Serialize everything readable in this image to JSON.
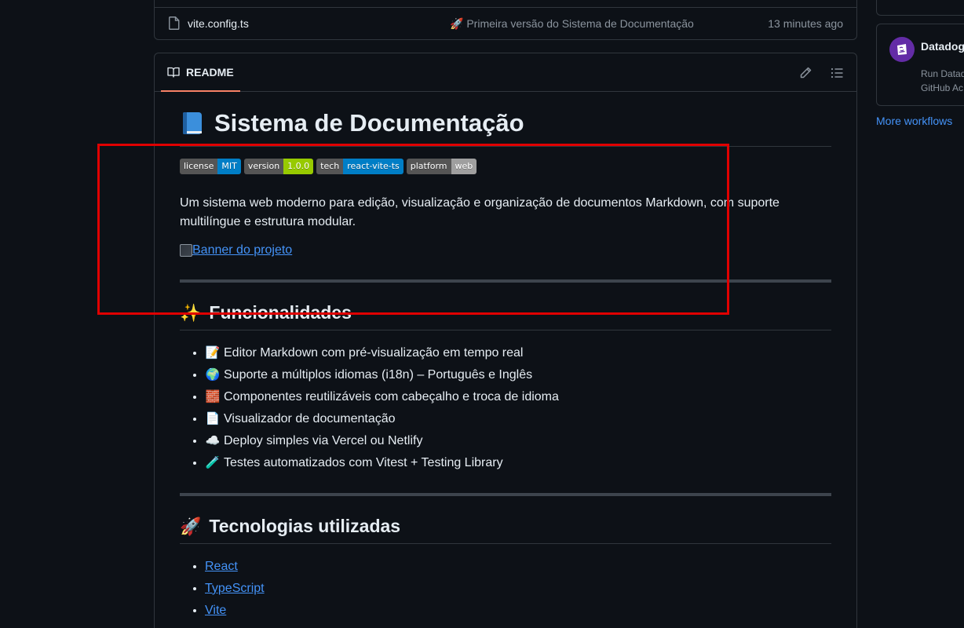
{
  "file_list": {
    "row": {
      "file_name": "vite.config.ts",
      "commit_emoji": "🚀",
      "commit_message": "Primeira versão do Sistema de Documentação",
      "commit_time": "13 minutes ago"
    }
  },
  "readme": {
    "tab_label": "README",
    "title_emoji": "book-icon",
    "title": "Sistema de Documentação",
    "badges": [
      {
        "label": "license",
        "value": "MIT",
        "color": "#007ec6"
      },
      {
        "label": "version",
        "value": "1.0.0",
        "color": "#97ca00"
      },
      {
        "label": "tech",
        "value": "react-vite-ts",
        "color": "#007ec6"
      },
      {
        "label": "platform",
        "value": "web",
        "color": "#9f9f9f"
      }
    ],
    "description": "Um sistema web moderno para edição, visualização e organização de documentos Markdown, com suporte multilíngue e estrutura modular.",
    "banner_alt": "Banner do projeto",
    "features": {
      "emoji": "✨",
      "heading": "Funcionalidades",
      "items": [
        {
          "emoji": "📝",
          "text": "Editor Markdown com pré-visualização em tempo real"
        },
        {
          "emoji": "🌍",
          "text": "Suporte a múltiplos idiomas (i18n) – Português e Inglês"
        },
        {
          "emoji": "🧱",
          "text": "Componentes reutilizáveis com cabeçalho e troca de idioma"
        },
        {
          "emoji": "📄",
          "text": "Visualizador de documentação"
        },
        {
          "emoji": "☁️",
          "text": "Deploy simples via Vercel ou Netlify"
        },
        {
          "emoji": "🧪",
          "text": "Testes automatizados com Vitest + Testing Library"
        }
      ]
    },
    "technologies": {
      "emoji": "🚀",
      "heading": "Tecnologias utilizadas",
      "items": [
        "React",
        "TypeScript",
        "Vite"
      ]
    }
  },
  "sidebar": {
    "workflow_card": {
      "title": "Datadog",
      "description_line1": "Run Datad",
      "description_line2": "GitHub Ac"
    },
    "more_workflows": "More workflows"
  },
  "colors": {
    "background": "#0d1117",
    "border": "#30363d",
    "link": "#4493f8",
    "tab_underline": "#f78166",
    "highlight": "#e00000"
  }
}
